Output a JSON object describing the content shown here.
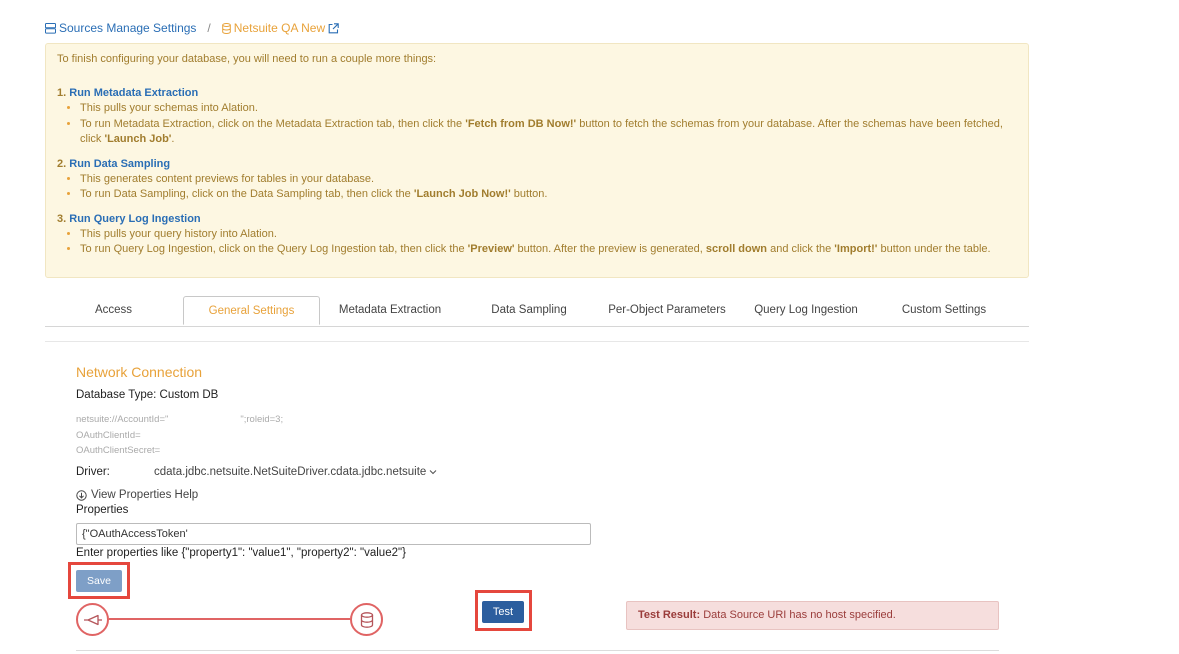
{
  "breadcrumb": {
    "parent": "Sources Manage Settings",
    "separator": "/",
    "current": "Netsuite QA New"
  },
  "info": {
    "intro": "To finish configuring your database, you will need to run a couple more things:",
    "steps": [
      {
        "num": "1.",
        "title": "Run Metadata Extraction",
        "b1": "This pulls your schemas into Alation.",
        "b2_a": "To run Metadata Extraction, click on the Metadata Extraction tab, then click the ",
        "b2_b": "'Fetch from DB Now!'",
        "b2_c": " button to fetch the schemas from your database. After the schemas have been fetched, click ",
        "b2_d": "'Launch Job'",
        "b2_e": "."
      },
      {
        "num": "2.",
        "title": "Run Data Sampling",
        "b1": "This generates content previews for tables in your database.",
        "b2_a": "To run Data Sampling, click on the Data Sampling tab, then click the ",
        "b2_b": "'Launch Job Now!'",
        "b2_c": " button."
      },
      {
        "num": "3.",
        "title": "Run Query Log Ingestion",
        "b1": "This pulls your query history into Alation.",
        "b2_a": "To run Query Log Ingestion, click on the Query Log Ingestion tab, then click the ",
        "b2_b": "'Preview'",
        "b2_c": " button. After the preview is generated, ",
        "b2_d": "scroll down",
        "b2_e": " and click the ",
        "b2_f": "'Import!'",
        "b2_g": " button under the table."
      }
    ]
  },
  "tabs": [
    "Access",
    "General Settings",
    "Metadata Extraction",
    "Data Sampling",
    "Per-Object Parameters",
    "Query Log Ingestion",
    "Custom Settings"
  ],
  "active_tab": "General Settings",
  "form": {
    "section_title": "Network Connection",
    "db_type": "Database Type: Custom DB",
    "uri_line1a": "netsuite://AccountId=\"",
    "uri_line1b": "\";roleid=3;",
    "uri_line2": "OAuthClientId=",
    "uri_line3": "OAuthClientSecret=",
    "driver_label": "Driver:",
    "driver_value": "cdata.jdbc.netsuite.NetSuiteDriver.cdata.jdbc.netsuite",
    "view_props_help": "View Properties Help",
    "properties_label": "Properties",
    "properties_value": "{\"OAuthAccessToken'",
    "properties_hint": "Enter properties like {\"property1\": \"value1\", \"property2\": \"value2\"}",
    "save_label": "Save",
    "test_label": "Test",
    "result_label": "Test Result:",
    "result_text": " Data Source URI has no host specified."
  },
  "colors": {
    "accent_orange": "#e8a23a",
    "link_blue": "#2a6eb5",
    "highlight_red": "#e5473d",
    "test_button": "#2c5e9e",
    "save_button": "#7e9fc7",
    "error_bg": "#f6dedd"
  },
  "icons": [
    "server-icon",
    "database-icon",
    "external-link-icon",
    "chevron-down-icon",
    "circle-arrow-down-icon",
    "connection-plug-icon"
  ]
}
